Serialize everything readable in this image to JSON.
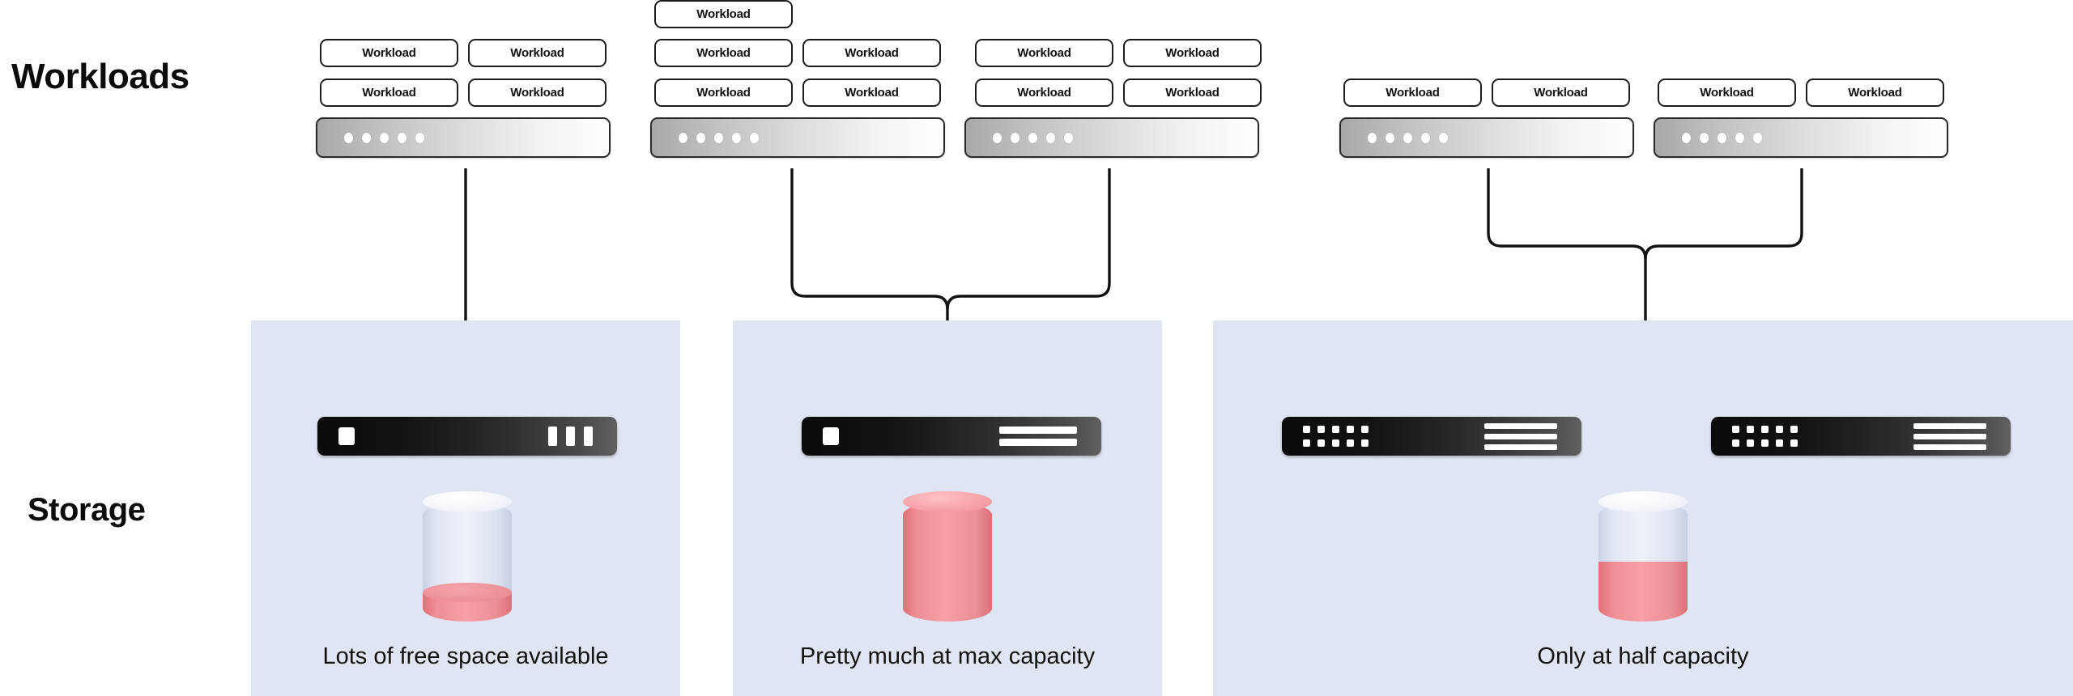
{
  "rows": {
    "workloads_label": "Workloads",
    "storage_label": "Storage"
  },
  "workload_label": "Workload",
  "compute_groups": [
    {
      "id": "group-1",
      "workloads": [
        "Workload",
        "Workload",
        "Workload",
        "Workload"
      ],
      "server": {
        "led_count": 5
      }
    },
    {
      "id": "group-2",
      "workloads": [
        "Workload",
        "Workload",
        "Workload",
        "Workload",
        "Workload"
      ],
      "server": {
        "led_count": 5
      }
    },
    {
      "id": "group-3",
      "workloads": [
        "Workload",
        "Workload",
        "Workload",
        "Workload"
      ],
      "server": {
        "led_count": 5
      }
    },
    {
      "id": "group-4",
      "workloads": [
        "Workload",
        "Workload"
      ],
      "server": {
        "led_count": 5
      }
    },
    {
      "id": "group-5",
      "workloads": [
        "Workload",
        "Workload"
      ],
      "server": {
        "led_count": 5
      }
    }
  ],
  "storage_panels": [
    {
      "id": "panel-1",
      "caption": "Lots of free space available",
      "appliance_icon": "storage-appliance-small",
      "capacity_percent": 25
    },
    {
      "id": "panel-2",
      "caption": "Pretty much at max capacity",
      "appliance_icon": "storage-appliance-medium",
      "capacity_percent": 100
    },
    {
      "id": "panel-3",
      "caption": "Only at half capacity",
      "appliance_icon": "storage-appliance-large",
      "capacity_percent": 50
    }
  ],
  "colors": {
    "panel_background": "#dfe5f3",
    "capacity_fill": "#ef8e95",
    "capacity_empty": "#dfe5f3",
    "connector": "#111111",
    "appliance": "#111111"
  }
}
